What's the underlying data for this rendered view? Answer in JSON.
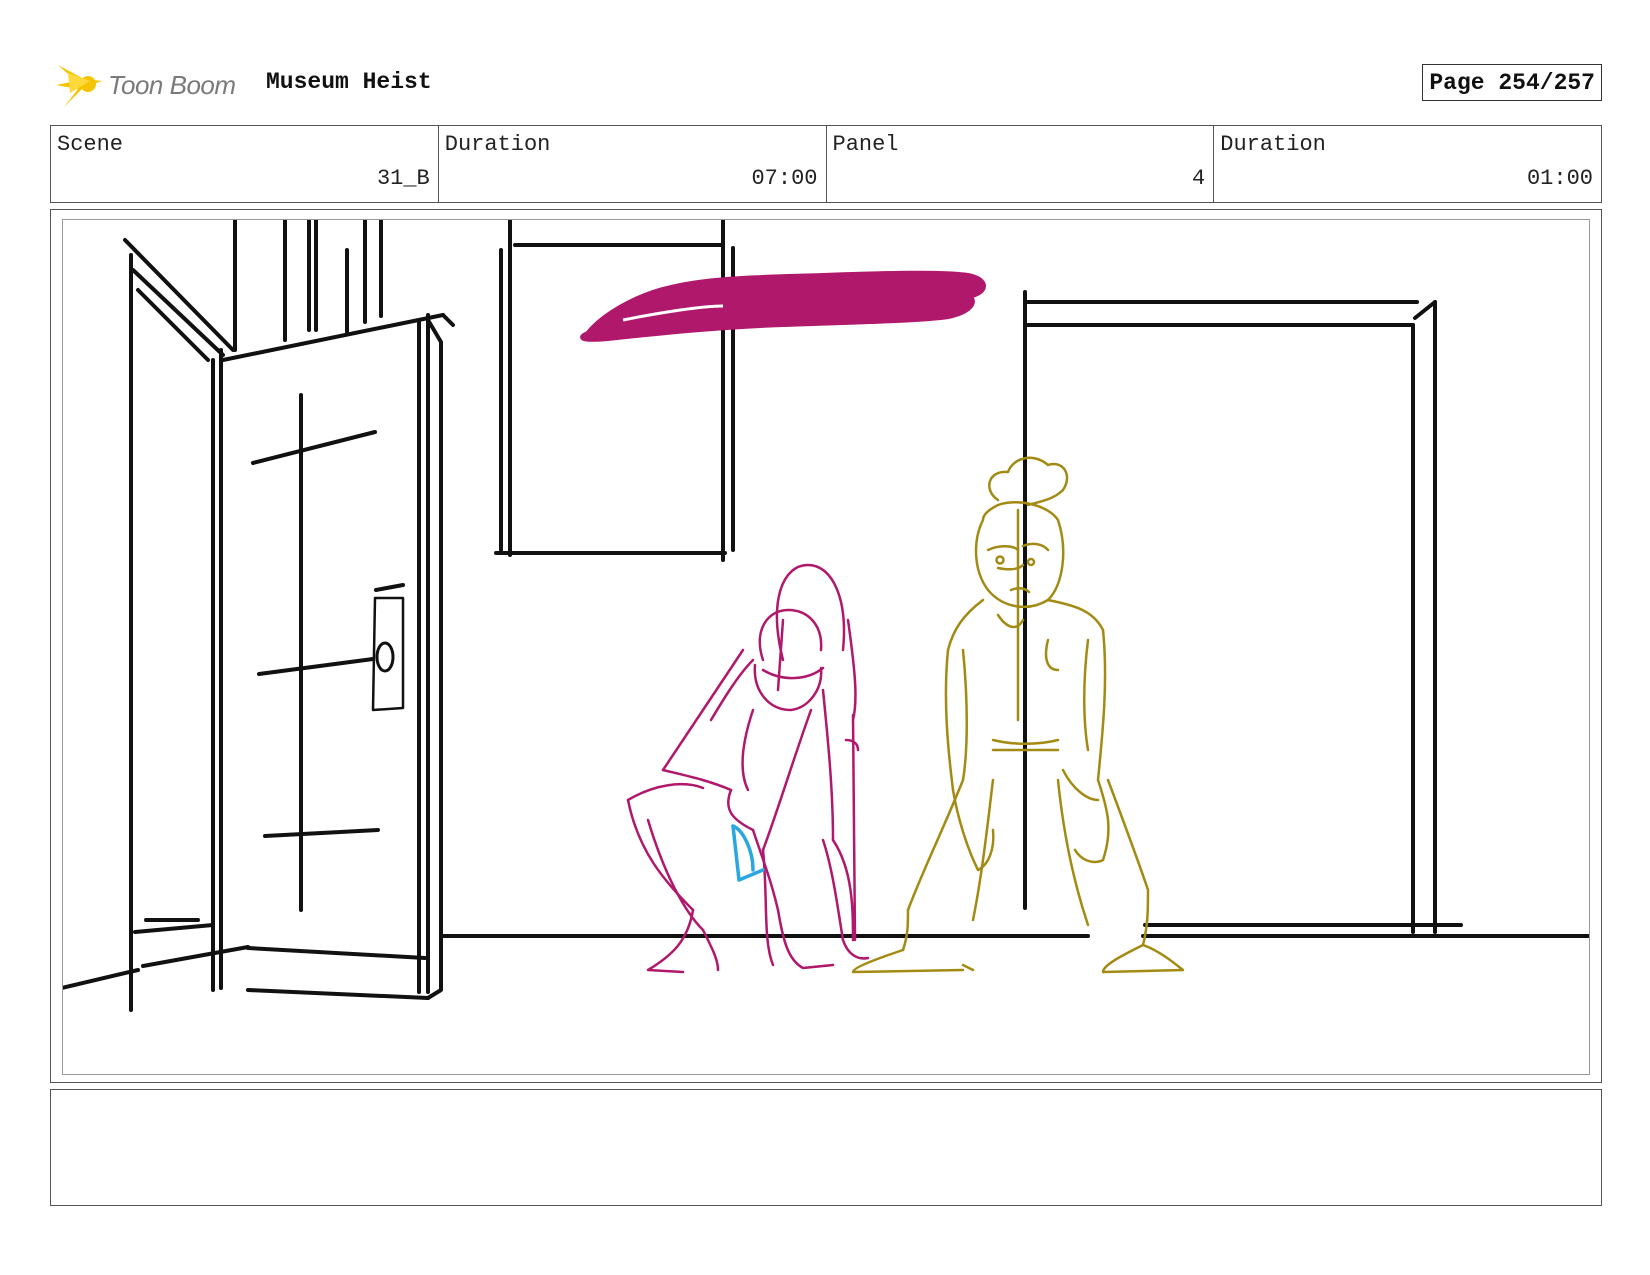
{
  "header": {
    "logo_text": "Toon Boom",
    "project_title": "Museum Heist",
    "page_label": "Page 254/257"
  },
  "info": {
    "scene_label": "Scene",
    "scene_value": "31_B",
    "scene_duration_label": "Duration",
    "scene_duration_value": "07:00",
    "panel_label": "Panel",
    "panel_value": "4",
    "panel_duration_label": "Duration",
    "panel_duration_value": "01:00"
  },
  "colors": {
    "logo_yellow": "#f5c400",
    "line_black": "#111111",
    "char1_magenta": "#b0186c",
    "char2_olive": "#a38a12",
    "accent_cyan": "#2aa7e0"
  },
  "notes": {
    "text": ""
  }
}
